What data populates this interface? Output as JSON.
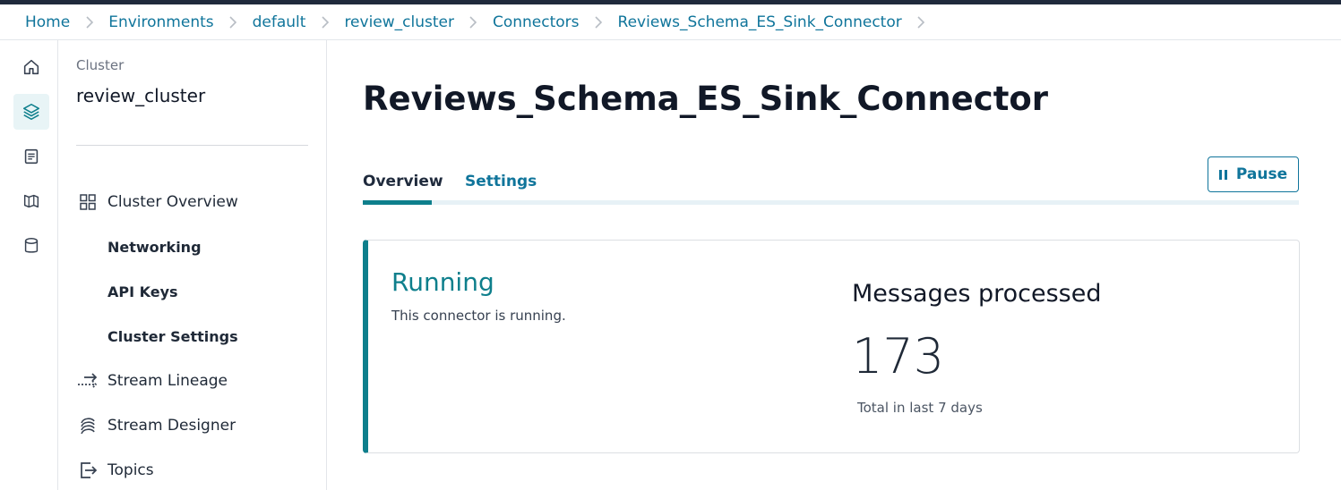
{
  "breadcrumb": [
    "Home",
    "Environments",
    "default",
    "review_cluster",
    "Connectors",
    "Reviews_Schema_ES_Sink_Connector"
  ],
  "rail": {
    "items": [
      "home-icon",
      "layers-icon",
      "document-icon",
      "map-icon",
      "database-icon"
    ],
    "active": "layers-icon"
  },
  "sidebar": {
    "section_label": "Cluster",
    "cluster_name": "review_cluster",
    "items": [
      {
        "label": "Cluster Overview",
        "icon": "grid-icon"
      },
      {
        "label": "Networking"
      },
      {
        "label": "API Keys"
      },
      {
        "label": "Cluster Settings"
      },
      {
        "label": "Stream Lineage",
        "icon": "arrows-icon"
      },
      {
        "label": "Stream Designer",
        "icon": "wave-icon"
      },
      {
        "label": "Topics",
        "icon": "topic-icon"
      }
    ]
  },
  "main": {
    "title": "Reviews_Schema_ES_Sink_Connector",
    "tabs": [
      {
        "label": "Overview",
        "active": true
      },
      {
        "label": "Settings",
        "active": false
      }
    ],
    "pause_label": "Pause",
    "status": {
      "label": "Running",
      "description": "This connector is running."
    },
    "metric": {
      "title": "Messages processed",
      "value": "173",
      "subtitle": "Total in last 7 days"
    }
  },
  "colors": {
    "accent": "#0e7f8c",
    "link": "#10759b",
    "topbar": "#1f2a3c"
  }
}
